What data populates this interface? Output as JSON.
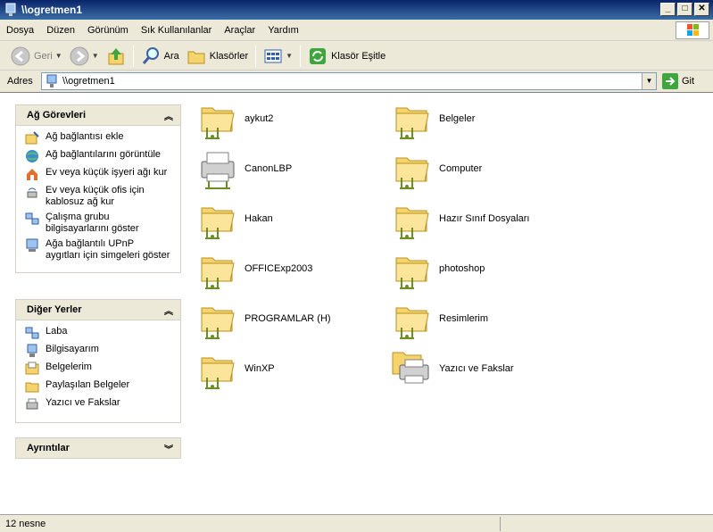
{
  "window": {
    "title": "\\\\ogretmen1",
    "minimize": "_",
    "maximize": "□",
    "close": "✕"
  },
  "menubar": [
    "Dosya",
    "Düzen",
    "Görünüm",
    "Sık Kullanılanlar",
    "Araçlar",
    "Yardım"
  ],
  "toolbar": {
    "back": "Geri",
    "search": "Ara",
    "folders": "Klasörler",
    "sync": "Klasör Eşitle"
  },
  "address": {
    "label": "Adres",
    "value": "\\\\ogretmen1",
    "go": "Git"
  },
  "network_tasks": {
    "title": "Ağ Görevleri",
    "items": [
      "Ağ bağlantısı ekle",
      "Ağ bağlantılarını görüntüle",
      "Ev veya küçük işyeri ağı kur",
      "Ev veya küçük ofis için kablosuz ağ kur",
      "Çalışma grubu bilgisayarlarını göster",
      "Ağa bağlantılı UPnP aygıtları için simgeleri göster"
    ]
  },
  "other_places": {
    "title": "Diğer Yerler",
    "items": [
      "Laba",
      "Bilgisayarım",
      "Belgelerim",
      "Paylaşılan Belgeler",
      "Yazıcı ve Fakslar"
    ]
  },
  "details": {
    "title": "Ayrıntılar"
  },
  "files": [
    {
      "name": "aykut2",
      "type": "share"
    },
    {
      "name": "Belgeler",
      "type": "share"
    },
    {
      "name": "CanonLBP",
      "type": "printer"
    },
    {
      "name": "Computer",
      "type": "share"
    },
    {
      "name": "Hakan",
      "type": "share"
    },
    {
      "name": "Hazır Sınıf Dosyaları",
      "type": "share"
    },
    {
      "name": "OFFICExp2003",
      "type": "share"
    },
    {
      "name": "photoshop",
      "type": "share"
    },
    {
      "name": "PROGRAMLAR (H)",
      "type": "share"
    },
    {
      "name": "Resimlerim",
      "type": "share"
    },
    {
      "name": "WinXP",
      "type": "share"
    },
    {
      "name": "Yazıcı ve Fakslar",
      "type": "printers-folder"
    }
  ],
  "status": {
    "text": "12 nesne"
  },
  "colors": {
    "titlebar": "#0a246a",
    "folder": "#f5d46e",
    "chrome": "#ece9d8"
  }
}
